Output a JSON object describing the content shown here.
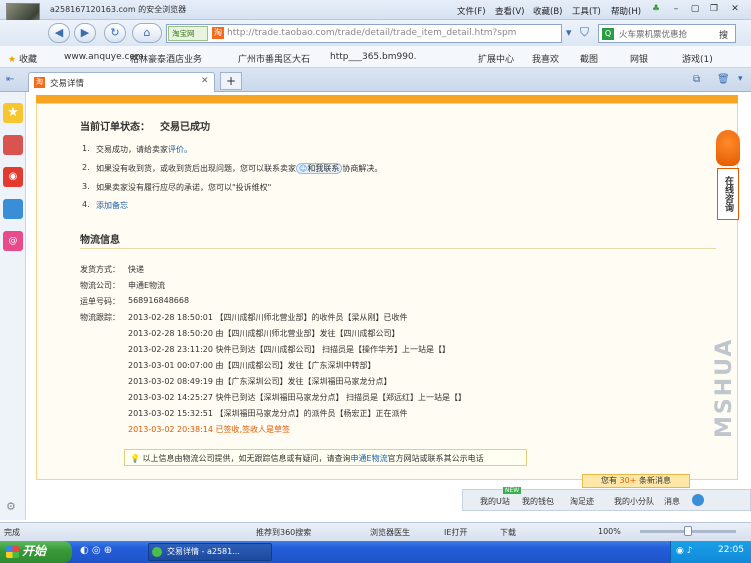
{
  "window": {
    "title": "a258167120163.com 的安全浏览器",
    "menus": [
      "文件(F)",
      "查看(V)",
      "收藏(B)",
      "工具(T)",
      "帮助(H)"
    ]
  },
  "nav": {
    "url_tag": "淘宝网",
    "url": "http://trade.taobao.com/trade/detail/trade_item_detail.htm?spm",
    "search_placeholder": "火车票机票优惠抢",
    "search_button": "搜"
  },
  "favorites": {
    "label": "收藏",
    "items": [
      "www.anquye.com",
      "格林豪泰酒店业务",
      "广州市番禺区大石",
      "http___365.bm990."
    ],
    "right_items": [
      "扩展中心",
      "我喜欢",
      "截图",
      "网银",
      "游戏(1)"
    ]
  },
  "tab": {
    "label": "交易详情",
    "new_tab": "+"
  },
  "order": {
    "status_label": "当前订单状态：",
    "status_value": "交易已成功",
    "steps": [
      {
        "num": "1.",
        "text": "交易成功，请给卖家",
        "link": "评价。"
      },
      {
        "num": "2.",
        "text": "如果没有收到货，或收到货后出现问题，您可以联系卖家",
        "badge": "和我联系",
        "tail": "协商解决。"
      },
      {
        "num": "3.",
        "text": "如果卖家没有履行应尽的承诺，您可以\"投诉维权\""
      },
      {
        "num": "4.",
        "link": "添加备忘"
      }
    ]
  },
  "logistics": {
    "heading": "物流信息",
    "method_label": "发货方式：",
    "method_value": "快递",
    "company_label": "物流公司：",
    "company_value": "申通E物流",
    "waybill_label": "运单号码：",
    "waybill_value": "568916848668",
    "tracking_label": "物流跟踪：",
    "tracking": [
      {
        "time": "2013-02-28 18:50:01",
        "text": "【四川成都川师北营业部】的收件员【梁从刚】已收件"
      },
      {
        "time": "2013-02-28 18:50:20",
        "text": "由【四川成都川师北营业部】发往【四川成都公司】"
      },
      {
        "time": "2013-02-28 23:11:20",
        "text": "快件已到达【四川成都公司】 扫描员是【操作华芳】上一站是【】"
      },
      {
        "time": "2013-03-01 00:07:00",
        "text": "由【四川成都公司】发往【广东深圳中转部】"
      },
      {
        "time": "2013-03-02 08:49:19",
        "text": "由【广东深圳公司】发往【深圳福田马家龙分点】"
      },
      {
        "time": "2013-03-02 14:25:27",
        "text": "快件已到达【深圳福田马家龙分点】 扫描员是【郑远红】上一站是【】"
      },
      {
        "time": "2013-03-02 15:32:51",
        "text": "【深圳福田马家龙分点】的派件员【杨宏正】正在派件"
      },
      {
        "time": "2013-03-02 20:38:14",
        "text": "已签收,签收人是草签",
        "highlight": true
      }
    ],
    "tip_pre": "以上信息由物流公司提供，如无跟踪信息或有疑问，请查询",
    "tip_link": "申通E物流",
    "tip_post": "官方网站或联系其公示电话"
  },
  "side_float": {
    "label": "在线咨询"
  },
  "messages": {
    "notice_pre": "您有",
    "notice_count": "30+",
    "notice_post": "条新消息",
    "new_badge": "NEW",
    "items": [
      "我的U站",
      "我的钱包",
      "淘足迹",
      "我的小分队",
      "消息"
    ]
  },
  "status": {
    "left": "完成",
    "items": [
      "推荐到360搜索",
      "浏览器医生",
      "IE打开",
      "下载"
    ],
    "zoom": "100%"
  },
  "taskbar": {
    "start": "开始",
    "task": "交易详情 - a2581...",
    "clock": "22:05"
  },
  "watermark": "MSHUA"
}
